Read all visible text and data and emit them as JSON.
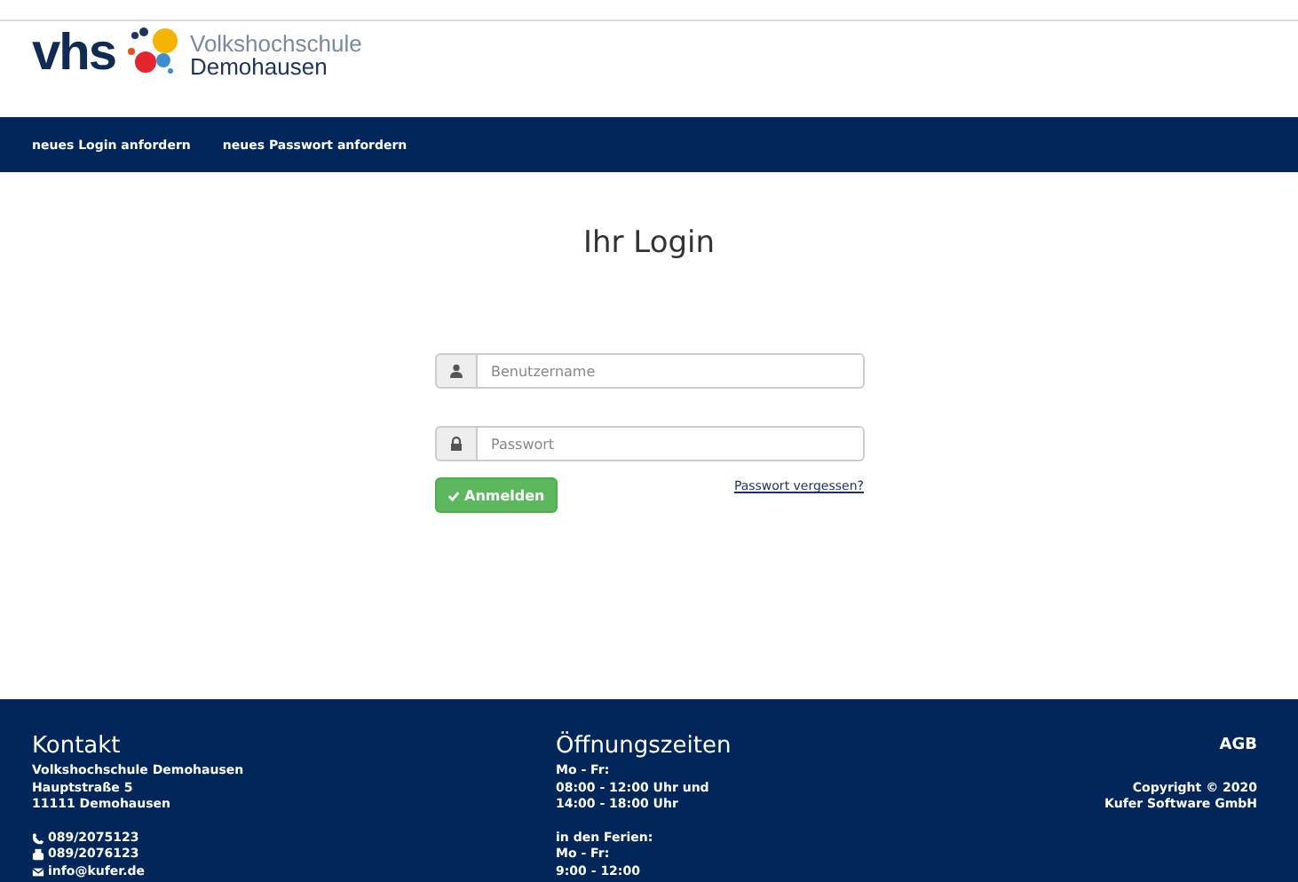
{
  "logo": {
    "mark": "vhs",
    "line_1": "Volkshochschule",
    "line_2": "Demohausen"
  },
  "nav": [
    "neues Login anfordern",
    "neues Passwort anfordern"
  ],
  "login": {
    "title": "Ihr Login",
    "fields": [
      {
        "kind": "user",
        "placeholder": "Benutzername"
      },
      {
        "kind": "password",
        "placeholder": "Passwort"
      }
    ],
    "submit": "Anmelden",
    "forgot_link": "Passwort vergessen?"
  },
  "footer": {
    "contact": {
      "heading": "Kontakt",
      "address": [
        "Volkshochschule Demohausen",
        "Hauptstraße 5",
        "11111 Demohausen"
      ],
      "items": [
        {
          "kind": "phone",
          "text": "089/2075123"
        },
        {
          "kind": "fax",
          "text": "089/2076123"
        },
        {
          "kind": "mail",
          "text": "info@kufer.de"
        }
      ]
    },
    "hours": {
      "heading": "Öffnungszeiten",
      "blocks": [
        [
          "Mo - Fr:",
          "08:00 - 12:00 Uhr und",
          "14:00 - 18:00 Uhr"
        ],
        [
          "in den Ferien:",
          "Mo - Fr:",
          "9:00 - 12:00"
        ]
      ]
    },
    "agb_link": "AGB",
    "copyright": [
      "Copyright © 2020",
      "Kufer Software GmbH"
    ]
  }
}
